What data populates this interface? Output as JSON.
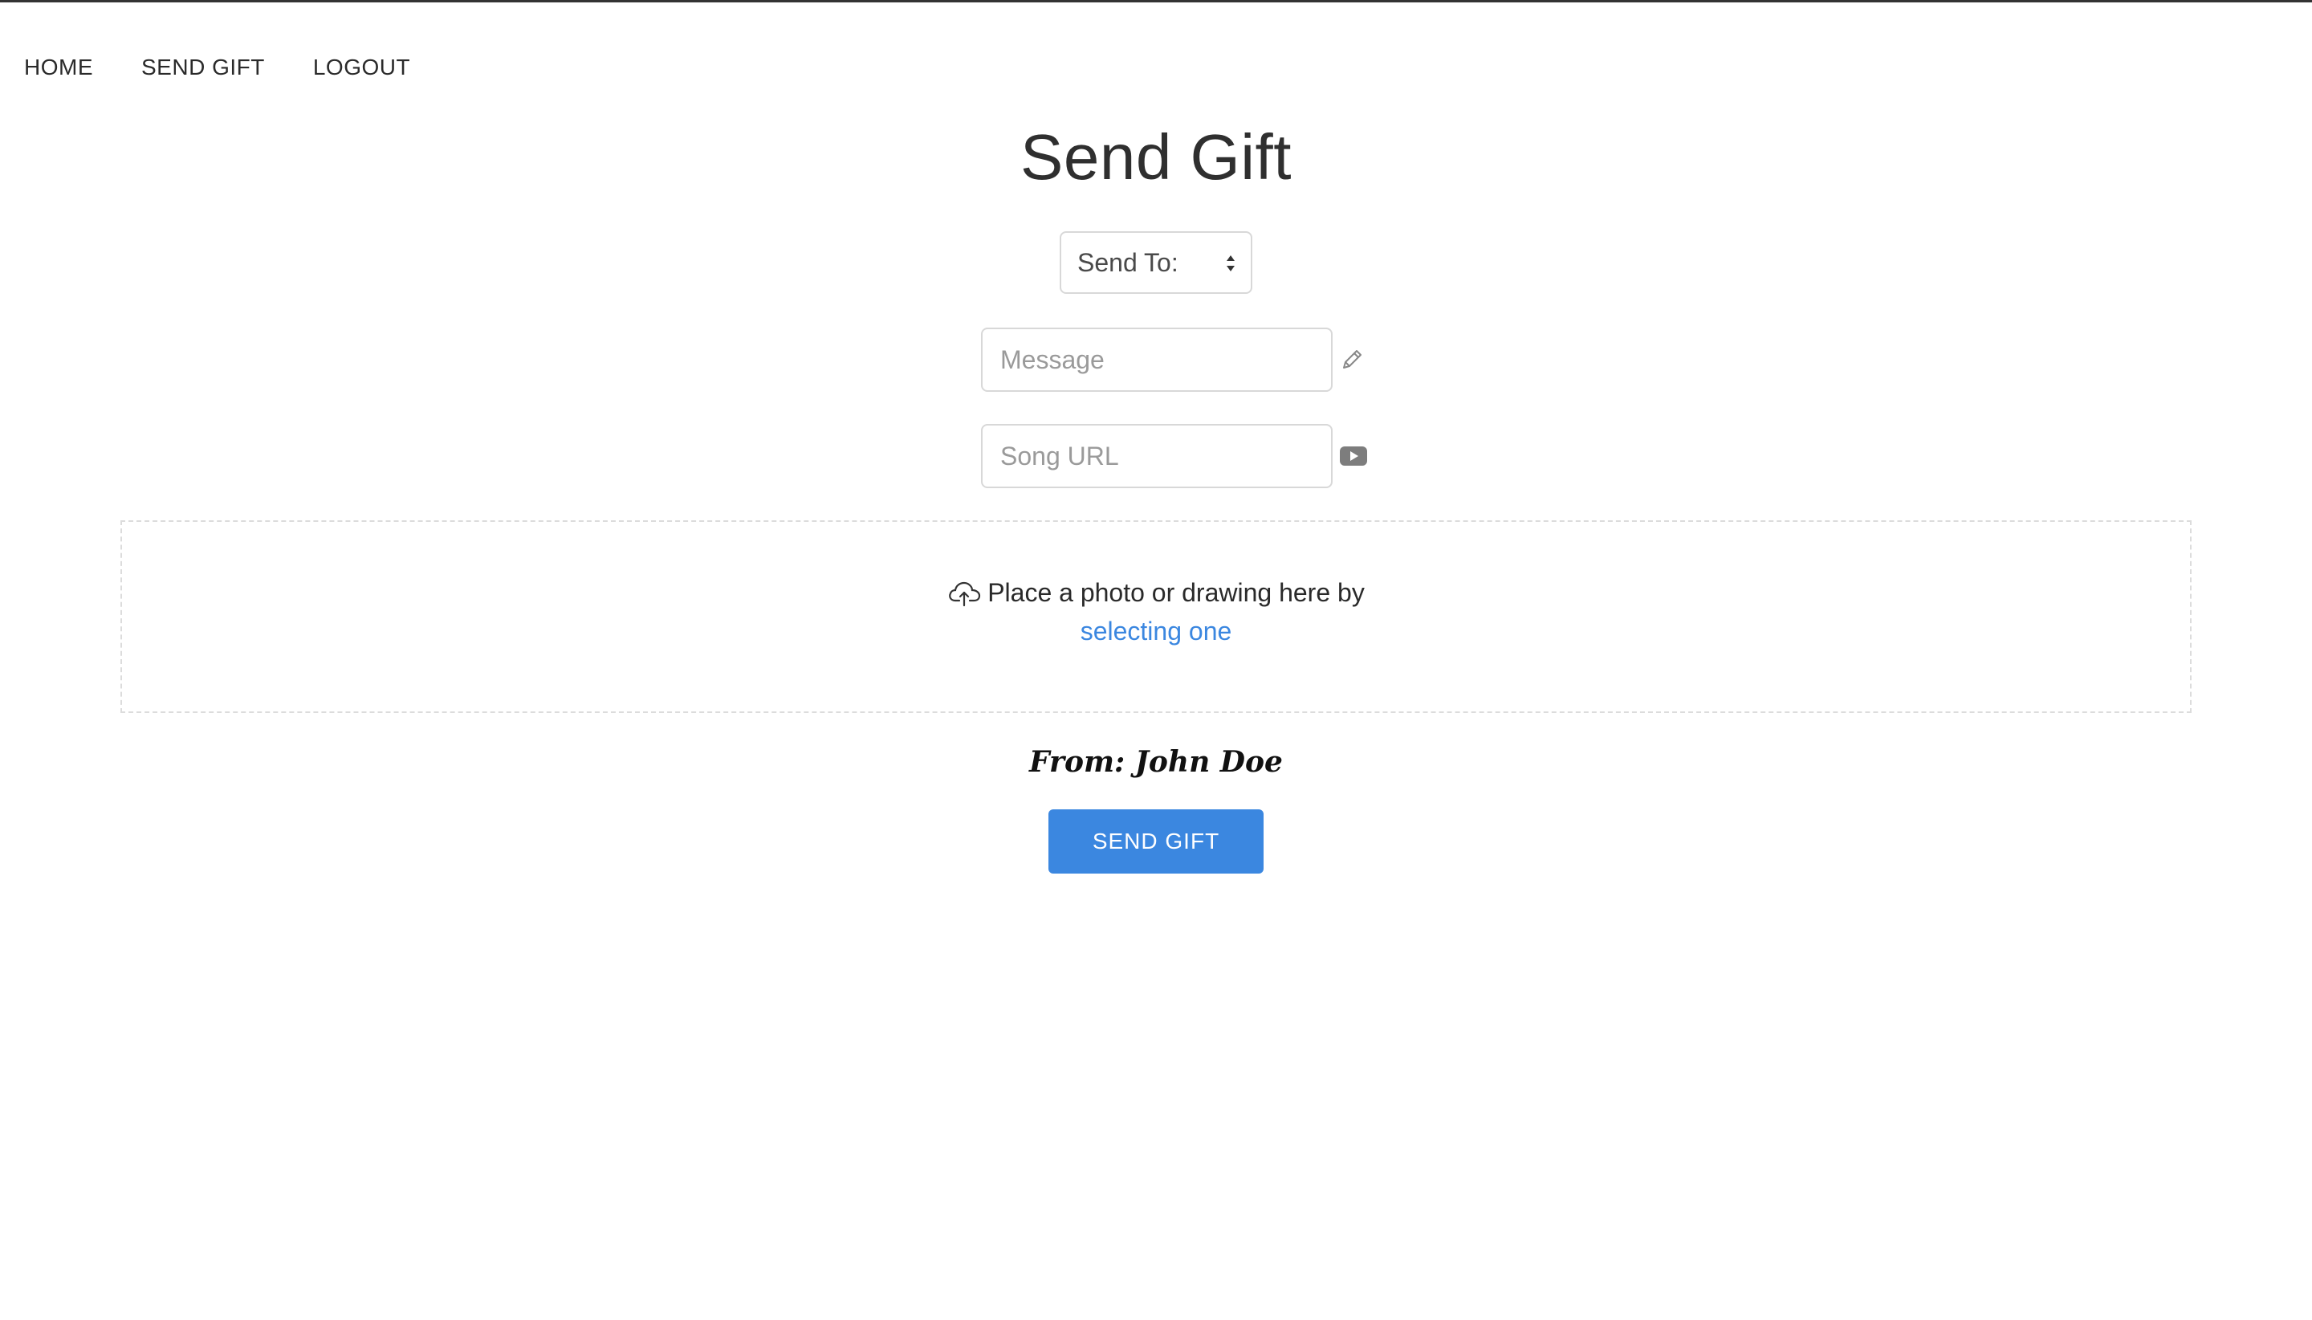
{
  "nav": {
    "items": [
      {
        "label": "HOME"
      },
      {
        "label": "SEND GIFT"
      },
      {
        "label": "LOGOUT"
      }
    ]
  },
  "page": {
    "title": "Send Gift"
  },
  "form": {
    "send_to": {
      "selected": "Send To:",
      "icon": "select-arrows-icon"
    },
    "message": {
      "placeholder": "Message",
      "value": "",
      "icon": "pencil-icon"
    },
    "song_url": {
      "placeholder": "Song URL",
      "value": "",
      "icon": "youtube-icon"
    },
    "dropzone": {
      "text": "Place a photo or drawing here by",
      "link": "selecting one",
      "icon": "cloud-upload-icon"
    },
    "from": "From: John Doe",
    "submit_label": "SEND GIFT"
  },
  "colors": {
    "accent": "#3b87e0",
    "border": "#d8d8d8",
    "text": "#2f2f2f"
  }
}
